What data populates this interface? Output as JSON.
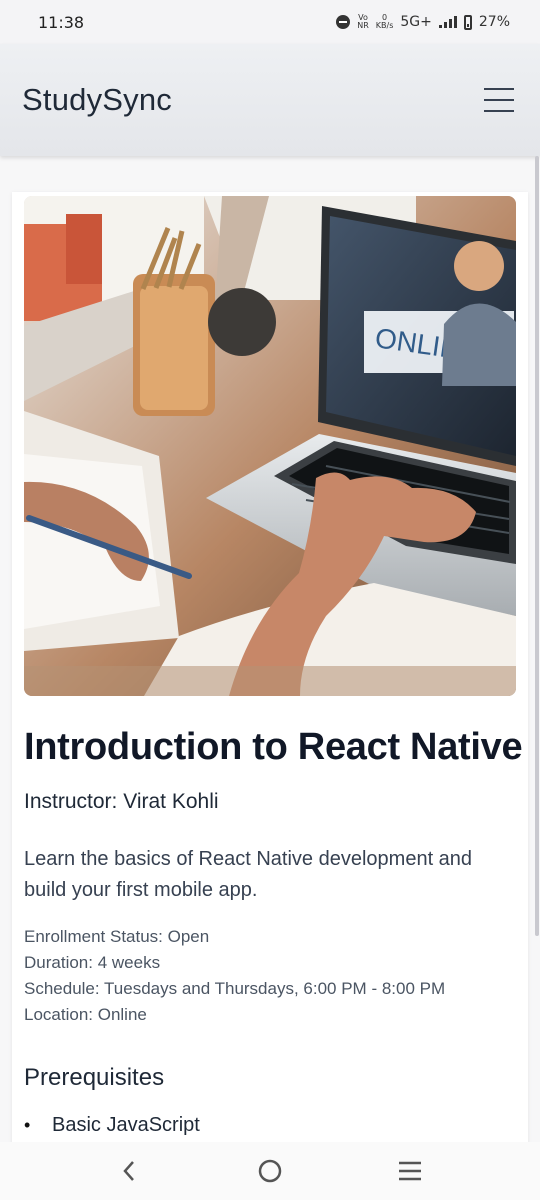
{
  "status_bar": {
    "time": "11:38",
    "volte": "Vo\nNR",
    "data_rate_value": "0",
    "data_rate_unit": "KB/s",
    "network": "5G+",
    "battery": "27%"
  },
  "header": {
    "app_title": "StudySync",
    "menu_icon": "hamburger-menu-icon"
  },
  "course": {
    "image_alt": "Laptop on desk showing online class",
    "image_overlay_text": "ONLINE C",
    "title": "Introduction to React Native",
    "instructor": "Instructor: Virat Kohli",
    "description": "Learn the basics of React Native development and build your first mobile app.",
    "details": [
      "Enrollment Status: Open",
      "Duration: 4 weeks",
      "Schedule: Tuesdays and Thursdays, 6:00 PM - 8:00 PM",
      "Location: Online"
    ],
    "prerequisites_heading": "Prerequisites",
    "prerequisites": [
      "Basic JavaScript"
    ]
  },
  "navigation": {
    "back_icon": "back-chevron-icon",
    "home_icon": "home-circle-icon",
    "recent_icon": "recent-apps-icon"
  },
  "colors": {
    "header_background": "#e4e6ea",
    "title_text": "#111827",
    "secondary_text": "#4b5563"
  }
}
